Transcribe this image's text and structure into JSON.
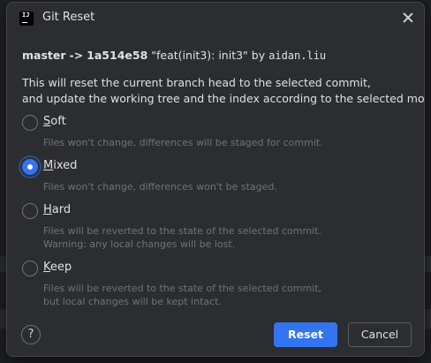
{
  "dialog": {
    "title": "Git Reset",
    "app_icon": "intellij-icon"
  },
  "commit": {
    "branch": "master",
    "arrow": "->",
    "hash": "1a514e58",
    "message": "\"feat(init3): init3\"",
    "by": "by",
    "author": "aidan.liu"
  },
  "description": {
    "line1": "This will reset the current branch head to the selected commit,",
    "line2": "and update the working tree and the index according to the selected mode:"
  },
  "options": [
    {
      "mnemonic": "S",
      "rest": "oft",
      "checked": false,
      "help1": "Files won't change, differences will be staged for commit.",
      "help2": ""
    },
    {
      "mnemonic": "M",
      "rest": "ixed",
      "checked": true,
      "help1": "Files won't change, differences won't be staged.",
      "help2": ""
    },
    {
      "mnemonic": "H",
      "rest": "ard",
      "checked": false,
      "help1": "Files will be reverted to the state of the selected commit.",
      "help2": "Warning: any local changes will be lost."
    },
    {
      "mnemonic": "K",
      "rest": "eep",
      "checked": false,
      "help1": "Files will be reverted to the state of the selected commit,",
      "help2": "but local changes will be kept intact."
    }
  ],
  "footer": {
    "help_label": "?",
    "reset_label": "Reset",
    "cancel_label": "Cancel"
  },
  "colors": {
    "accent": "#3574f0",
    "dialog_bg": "#2b2d30",
    "muted_text": "#6f737a"
  }
}
